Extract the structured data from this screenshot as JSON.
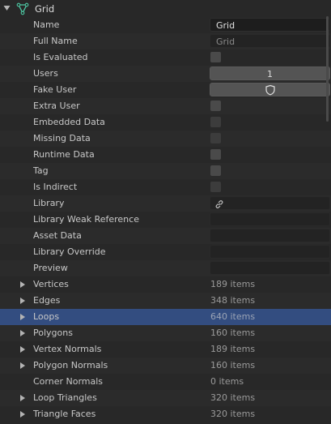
{
  "header": {
    "title": "Grid",
    "expander_icon": "chevron-down-icon",
    "object_icon": "mesh-data-icon"
  },
  "properties": [
    {
      "key": "name",
      "label": "Name",
      "kind": "text",
      "value": "Grid"
    },
    {
      "key": "full_name",
      "label": "Full Name",
      "kind": "text-readonly",
      "value": "Grid"
    },
    {
      "key": "is_evaluated",
      "label": "Is Evaluated",
      "kind": "checkbox",
      "checked": false
    },
    {
      "key": "users",
      "label": "Users",
      "kind": "number",
      "value": "1"
    },
    {
      "key": "fake_user",
      "label": "Fake User",
      "kind": "toggle",
      "icon": "shield-icon"
    },
    {
      "key": "extra_user",
      "label": "Extra User",
      "kind": "checkbox",
      "checked": false
    },
    {
      "key": "embedded_data",
      "label": "Embedded Data",
      "kind": "checkbox",
      "checked": false
    },
    {
      "key": "missing_data",
      "label": "Missing Data",
      "kind": "checkbox",
      "checked": false
    },
    {
      "key": "runtime_data",
      "label": "Runtime Data",
      "kind": "checkbox",
      "checked": false
    },
    {
      "key": "tag",
      "label": "Tag",
      "kind": "checkbox",
      "checked": false
    },
    {
      "key": "is_indirect",
      "label": "Is Indirect",
      "kind": "checkbox",
      "checked": false
    },
    {
      "key": "library",
      "label": "Library",
      "kind": "pointer",
      "icon": "link-icon"
    },
    {
      "key": "library_weak_reference",
      "label": "Library Weak Reference",
      "kind": "pointer"
    },
    {
      "key": "asset_data",
      "label": "Asset Data",
      "kind": "pointer"
    },
    {
      "key": "library_override",
      "label": "Library Override",
      "kind": "pointer"
    },
    {
      "key": "preview",
      "label": "Preview",
      "kind": "pointer"
    }
  ],
  "collections": [
    {
      "label": "Vertices",
      "count": "189 items",
      "expandable": true,
      "selected": false
    },
    {
      "label": "Edges",
      "count": "348 items",
      "expandable": true,
      "selected": false
    },
    {
      "label": "Loops",
      "count": "640 items",
      "expandable": true,
      "selected": true
    },
    {
      "label": "Polygons",
      "count": "160 items",
      "expandable": true,
      "selected": false
    },
    {
      "label": "Vertex Normals",
      "count": "189 items",
      "expandable": true,
      "selected": false
    },
    {
      "label": "Polygon Normals",
      "count": "160 items",
      "expandable": true,
      "selected": false
    },
    {
      "label": "Corner Normals",
      "count": "0 items",
      "expandable": false,
      "selected": false
    },
    {
      "label": "Loop Triangles",
      "count": "320 items",
      "expandable": true,
      "selected": false
    },
    {
      "label": "Triangle Faces",
      "count": "320 items",
      "expandable": true,
      "selected": false
    }
  ],
  "colors": {
    "background": "#282828",
    "selected_row": "#334d80",
    "accent_icon": "#4ec9a4"
  }
}
